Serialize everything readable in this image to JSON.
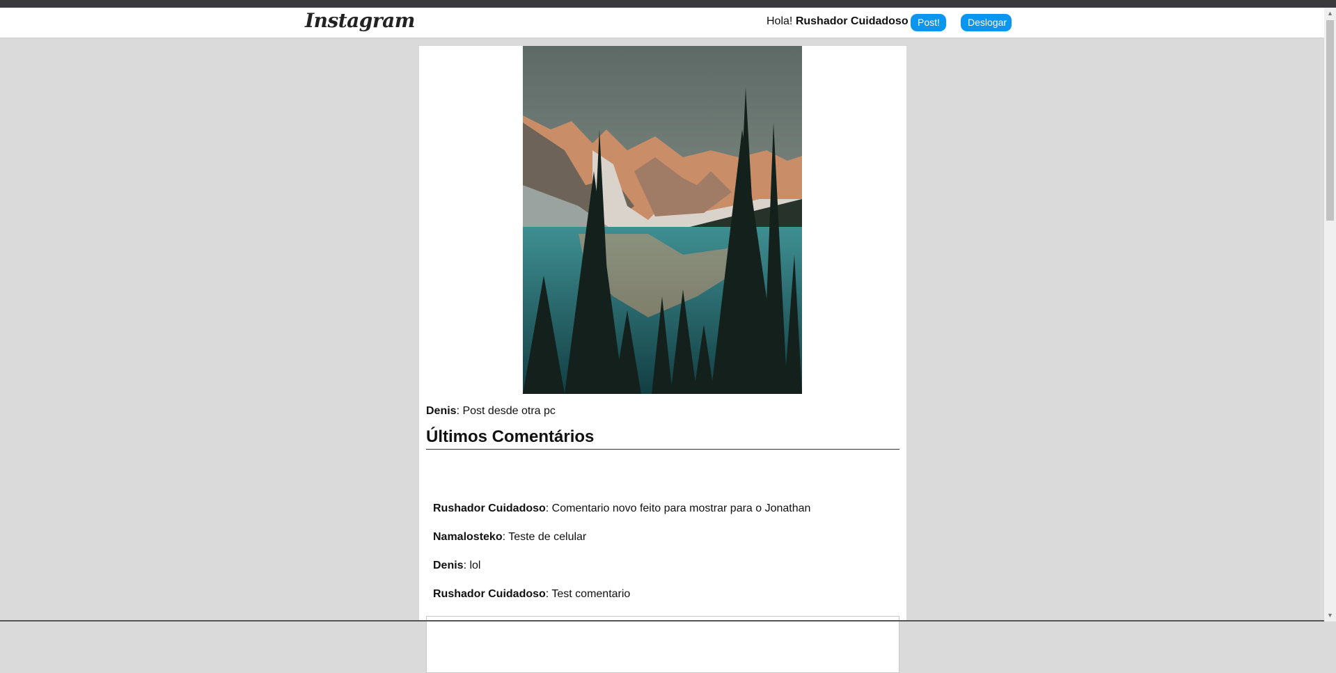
{
  "header": {
    "logo": "Instagram",
    "greeting_prefix": "Hola!",
    "username": "Rushador Cuidadoso",
    "post_button": "Post!",
    "logout_button": "Deslogar",
    "accent_color": "#0a95f0"
  },
  "post": {
    "author": "Denis",
    "caption": ": Post desde otra pc",
    "image_alt": "mountain-lake-photo"
  },
  "comments": {
    "title": "Últimos Comentários",
    "items": [
      {
        "author": "Rushador Cuidadoso",
        "text": ": Comentario novo feito para mostrar para o Jonathan"
      },
      {
        "author": "Namalosteko",
        "text": ": Teste de celular"
      },
      {
        "author": "Denis",
        "text": ": lol"
      },
      {
        "author": "Rushador Cuidadoso",
        "text": ": Test comentario"
      }
    ]
  }
}
